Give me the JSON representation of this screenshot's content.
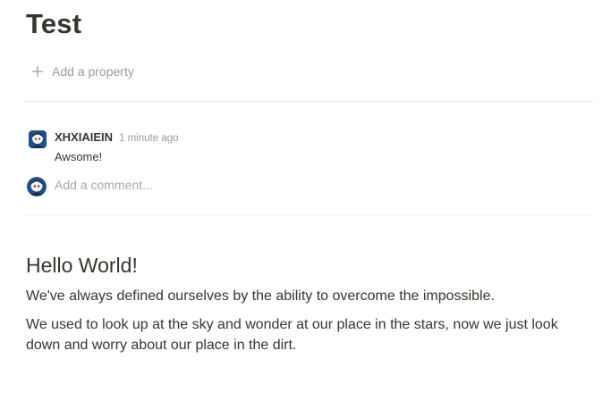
{
  "page": {
    "title": "Test",
    "add_property_label": "Add a property"
  },
  "comments": {
    "items": [
      {
        "author": "XHXIAIEIN",
        "timestamp": "1 minute ago",
        "text": "Awsome!"
      }
    ],
    "input_placeholder": "Add a comment..."
  },
  "content": {
    "heading": "Hello World!",
    "paragraphs": [
      "We've always defined ourselves by the ability to overcome the impossible.",
      "We used to look up at the sky and wonder at our place in the stars, now we just look down and worry about our place in the dirt."
    ]
  },
  "icons": {
    "add_property": "plus-icon",
    "comment_avatar": "avatar",
    "input_avatar": "avatar"
  },
  "colors": {
    "text": "#37352f",
    "muted": "#9b9a97",
    "divider": "#ebebea",
    "avatar_bg": "#1f4e8c"
  }
}
